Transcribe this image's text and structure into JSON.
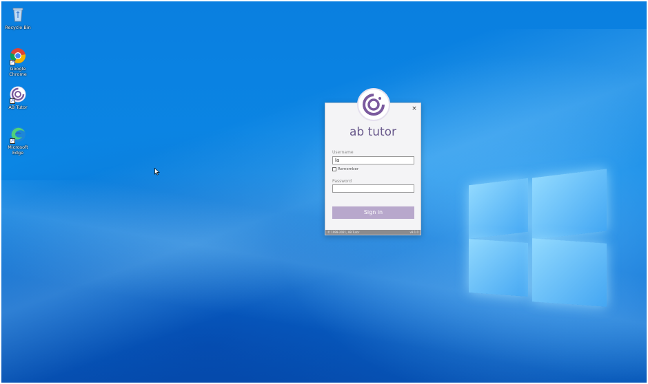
{
  "desktop": {
    "icons": [
      {
        "label": "Recycle Bin",
        "icon": "recycle-bin-icon"
      },
      {
        "label": "Google Chrome",
        "icon": "chrome-icon"
      },
      {
        "label": "AB Tutor",
        "icon": "ab-tutor-icon"
      },
      {
        "label": "Microsoft Edge",
        "icon": "edge-icon"
      }
    ]
  },
  "login": {
    "app_name": "ab tutor",
    "close_glyph": "×",
    "username_label": "Username",
    "username_value": "la",
    "remember_label": "Remember",
    "password_label": "Password",
    "password_value": "",
    "signin_label": "Sign in",
    "footer_left": "© 1999-2021, AB Tutor",
    "footer_right": "v9.1.0"
  },
  "colors": {
    "accent": "#6a5a8c",
    "button": "#b8a8cc",
    "desktop_blue": "#0b86e4"
  }
}
